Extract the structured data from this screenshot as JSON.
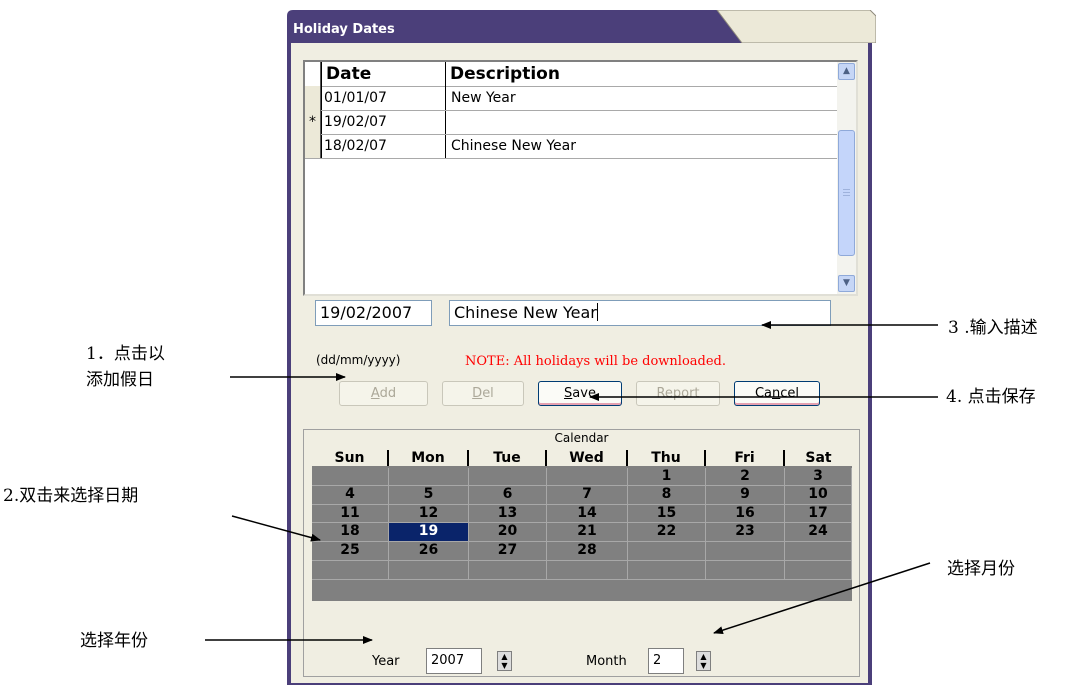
{
  "window": {
    "title": "Holiday Dates",
    "frame_color": "#4b3f7a"
  },
  "grid": {
    "columns": [
      "Date",
      "Description"
    ],
    "rows": [
      {
        "marker": "",
        "date": "01/01/07",
        "description": "New Year"
      },
      {
        "marker": "*",
        "date": "19/02/07",
        "description": ""
      },
      {
        "marker": "",
        "date": "18/02/07",
        "description": "Chinese New Year"
      }
    ]
  },
  "form": {
    "date_value": "19/02/2007",
    "date_format": "(dd/mm/yyyy)",
    "description_value": "Chinese New Year",
    "note": "NOTE: All holidays will be downloaded."
  },
  "buttons": {
    "add": {
      "prefix": "",
      "key": "A",
      "rest": "dd"
    },
    "del": {
      "prefix": "",
      "key": "D",
      "rest": "el"
    },
    "save": {
      "prefix": "",
      "key": "S",
      "rest": "ave"
    },
    "report": {
      "label": "Report"
    },
    "cancel": {
      "prefix": "Ca",
      "key": "n",
      "rest": "cel"
    }
  },
  "calendar": {
    "title": "Calendar",
    "day_headers": [
      "Sun",
      "Mon",
      "Tue",
      "Wed",
      "Thu",
      "Fri",
      "Sat"
    ],
    "weeks": [
      [
        "",
        "",
        "",
        "",
        "1",
        "2",
        "3"
      ],
      [
        "4",
        "5",
        "6",
        "7",
        "8",
        "9",
        "10"
      ],
      [
        "11",
        "12",
        "13",
        "14",
        "15",
        "16",
        "17"
      ],
      [
        "18",
        "19",
        "20",
        "21",
        "22",
        "23",
        "24"
      ],
      [
        "25",
        "26",
        "27",
        "28",
        "",
        "",
        ""
      ],
      [
        "",
        "",
        "",
        "",
        "",
        "",
        ""
      ]
    ],
    "selected_day": "19",
    "highlight_color": "#0a246a"
  },
  "controls": {
    "year_label": "Year",
    "year_value": "2007",
    "month_label": "Month",
    "month_value": "2"
  },
  "annotations": {
    "add_line1": "1．点击以",
    "add_line2": "添加假日",
    "select_date": "2.双击来选择日期",
    "input_desc": "3 .输入描述",
    "save": "4. 点击保存",
    "select_month": "选择月份",
    "select_year": "选择年份"
  }
}
